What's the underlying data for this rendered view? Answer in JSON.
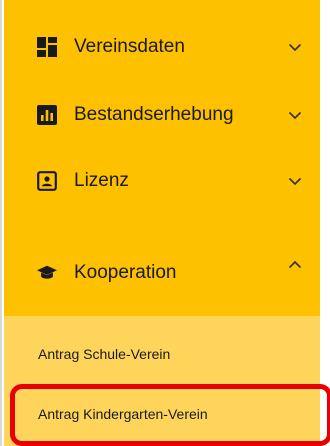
{
  "menu": {
    "items": [
      {
        "label": "Vereinsdaten",
        "icon": "dashboard-icon",
        "chevron": "chevron-down-icon"
      },
      {
        "label": "Bestandserhebung",
        "icon": "bar-chart-icon",
        "chevron": "chevron-down-icon"
      },
      {
        "label": "Lizenz",
        "icon": "id-card-icon",
        "chevron": "chevron-down-icon"
      },
      {
        "label": "Kooperation",
        "icon": "graduation-cap-icon",
        "chevron": "chevron-up-icon"
      }
    ],
    "subitems": [
      {
        "label": "Antrag Schule-Verein"
      },
      {
        "label": "Antrag Kindergarten-Verein"
      }
    ]
  },
  "colors": {
    "menu_background": "#fdc100",
    "submenu_background": "#fed55a",
    "highlight_border": "#e60000"
  }
}
